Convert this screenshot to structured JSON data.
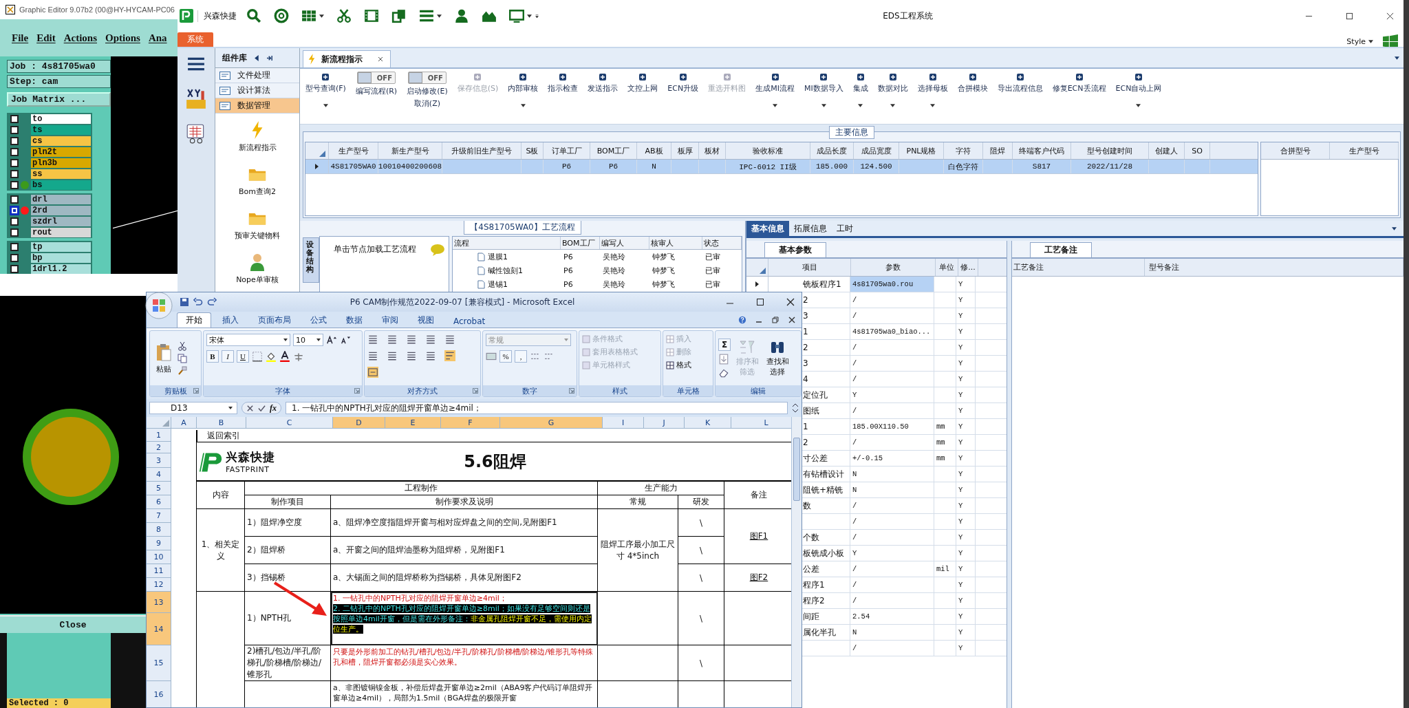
{
  "graphic_editor": {
    "title": "Graphic Editor 9.07b2 (00@HY-HYCAM-PC06",
    "menu": [
      "File",
      "Edit",
      "Actions",
      "Options",
      "Ana"
    ],
    "job": "Job : 4s81705wa0",
    "step": "Step: cam",
    "matrix_button": "Job Matrix ...",
    "layer_groups": [
      [
        {
          "name": "to",
          "color": "#ffffff",
          "selected": false
        },
        {
          "name": "ts",
          "color": "#14a88c",
          "selected": false
        },
        {
          "name": "cs",
          "color": "#f6c445",
          "selected": false
        },
        {
          "name": "pln2t",
          "color": "#d8a800",
          "selected": false
        },
        {
          "name": "pln3b",
          "color": "#d8a800",
          "selected": false
        },
        {
          "name": "ss",
          "color": "#f6c445",
          "selected": false
        },
        {
          "name": "bs",
          "color": "#14a88c",
          "selected": false,
          "dot": {
            "color": "#3c9a1c"
          }
        }
      ],
      [
        {
          "name": "drl",
          "color": "#9fb8c2",
          "selected": false
        },
        {
          "name": "2rd",
          "color": "#9fb8c2",
          "selected": true,
          "dot": {
            "color": "#ff1a1a"
          }
        },
        {
          "name": "szdrl",
          "color": "#9fb8c2",
          "selected": false
        },
        {
          "name": "rout",
          "color": "#d8d8d8",
          "selected": false
        }
      ],
      [
        {
          "name": "tp",
          "color": "#a8dfda",
          "selected": false
        },
        {
          "name": "bp",
          "color": "#a8dfda",
          "selected": false
        },
        {
          "name": "1drl1.2",
          "color": "#a8dfda",
          "selected": false
        }
      ]
    ],
    "close_button": "Close",
    "selected_count": "Selected : 0"
  },
  "eds": {
    "brand": "兴森快捷",
    "title": "EDS工程系统",
    "system_tab": "系统",
    "style_menu": "Style",
    "sidebar_title": "组件库",
    "modules": [
      {
        "label": "文件处理",
        "selected": false
      },
      {
        "label": "设计算法",
        "selected": false
      },
      {
        "label": "数据管理",
        "selected": true
      }
    ],
    "launchers": [
      "新流程指示",
      "Bom查询2",
      "预审关键物料",
      "Nope单审核"
    ],
    "doc_tab": "新流程指示",
    "toolbar": [
      {
        "kind": "button",
        "label": "型号查询(F)",
        "disabled": false,
        "menu": true
      },
      {
        "kind": "toggle",
        "label": "编写流程(R)",
        "switch_text": "OFF",
        "on": false
      },
      {
        "kind": "toggle",
        "label": "启动修改(E)",
        "sublabel": "取消(Z)",
        "switch_text": "OFF",
        "on": false
      },
      {
        "kind": "button",
        "label": "保存信息(S)",
        "disabled": true,
        "menu": false
      },
      {
        "kind": "button",
        "label": "内部审核",
        "disabled": false,
        "menu": true
      },
      {
        "kind": "button",
        "label": "指示检查",
        "disabled": false,
        "menu": false
      },
      {
        "kind": "button",
        "label": "发送指示",
        "disabled": false,
        "menu": false
      },
      {
        "kind": "button",
        "label": "文控上网",
        "disabled": false,
        "menu": false
      },
      {
        "kind": "button",
        "label": "ECN升级",
        "disabled": false,
        "menu": false
      },
      {
        "kind": "button",
        "label": "重选开料图",
        "disabled": true,
        "menu": false
      },
      {
        "kind": "button",
        "label": "生成MI流程",
        "disabled": false,
        "menu": true
      },
      {
        "kind": "button",
        "label": "MI数据导入",
        "disabled": false,
        "menu": true
      },
      {
        "kind": "button",
        "label": "集成",
        "disabled": false,
        "menu": true
      },
      {
        "kind": "button",
        "label": "数据对比",
        "disabled": false,
        "menu": true
      },
      {
        "kind": "button",
        "label": "选择母板",
        "disabled": false,
        "menu": true
      },
      {
        "kind": "button",
        "label": "合拼模块",
        "disabled": false,
        "menu": false
      },
      {
        "kind": "button",
        "label": "导出流程信息",
        "disabled": false,
        "menu": false
      },
      {
        "kind": "button",
        "label": "修复ECN丢流程",
        "disabled": false,
        "menu": false
      },
      {
        "kind": "button",
        "label": "ECN自动上网",
        "disabled": false,
        "menu": true
      }
    ],
    "main_info": {
      "title": "主要信息",
      "columns": [
        "生产型号",
        "新生产型号",
        "升级前旧生产型号",
        "S板",
        "订单工厂",
        "BOM工厂",
        "AB板",
        "板厚",
        "板材",
        "验收标准",
        "成品长度",
        "成品宽度",
        "PNL规格",
        "字符",
        "阻焊",
        "终端客户代码",
        "型号创建时间",
        "创建人",
        "SO"
      ],
      "rows": [
        {
          "selected": true,
          "cells": [
            "4S81705WA0",
            "10010400200608",
            null,
            null,
            "P6",
            "P6",
            "N",
            null,
            null,
            "IPC-6012 II级",
            "185.000",
            "124.500",
            null,
            "白色字符",
            null,
            "S817",
            "2022/11/28",
            null,
            null
          ]
        }
      ],
      "merge_columns": [
        "合拼型号",
        "生产型号"
      ]
    },
    "flow": {
      "title": "【4S81705WA0】工艺流程",
      "side_tab": "设备结构",
      "hint": "单击节点加载工艺流程",
      "columns": [
        "流程",
        "BOM工厂",
        "编写人",
        "核审人",
        "状态"
      ],
      "rows": [
        [
          "退膜1",
          "P6",
          "吴艳玲",
          "钟梦飞",
          "已审"
        ],
        [
          "碱性蚀刻1",
          "P6",
          "吴艳玲",
          "钟梦飞",
          "已审"
        ],
        [
          "退锡1",
          "P6",
          "吴艳玲",
          "钟梦飞",
          "已审"
        ]
      ]
    },
    "detail_tabs": [
      {
        "label": "基本信息",
        "selected": true
      },
      {
        "label": "拓展信息",
        "selected": false
      },
      {
        "label": "工时",
        "selected": false
      }
    ],
    "params": {
      "tab": "基本参数",
      "columns": [
        "项目",
        "参数",
        "单位",
        "修..."
      ],
      "rows": [
        {
          "item": "铣板程序1",
          "value": "4s81705wa0.rou",
          "flag": "Y",
          "selected": true
        },
        {
          "item": "2",
          "value": "/",
          "flag": "Y",
          "selected": false
        },
        {
          "item": "3",
          "value": "/",
          "flag": "Y",
          "selected": false
        },
        {
          "item": "1",
          "value": "4s81705wa0_biao...",
          "flag": "Y",
          "selected": false
        },
        {
          "item": "2",
          "value": "/",
          "flag": "Y",
          "selected": false
        },
        {
          "item": "3",
          "value": "/",
          "flag": "Y",
          "selected": false
        },
        {
          "item": "4",
          "value": "/",
          "flag": "Y",
          "selected": false
        },
        {
          "item": "定位孔",
          "value": "Y",
          "flag": "Y",
          "selected": false
        },
        {
          "item": "图纸",
          "value": "/",
          "flag": "Y",
          "selected": false
        },
        {
          "item": "1",
          "value": "185.00X110.50",
          "unit": "mm",
          "flag": "Y",
          "selected": false
        },
        {
          "item": "2",
          "value": "/",
          "unit": "mm",
          "flag": "Y",
          "selected": false
        },
        {
          "item": "寸公差",
          "value": "+/-0.15",
          "unit": "mm",
          "flag": "Y",
          "selected": false
        },
        {
          "item": "有钻槽设计",
          "value": "N",
          "flag": "Y",
          "selected": false
        },
        {
          "item": "阻铣+精铣",
          "value": "N",
          "flag": "Y",
          "selected": false
        },
        {
          "item": "数",
          "value": "/",
          "flag": "Y",
          "selected": false
        },
        {
          "value": "/",
          "flag": "Y",
          "selected": false
        },
        {
          "item": "个数",
          "value": "/",
          "flag": "Y",
          "selected": false
        },
        {
          "item": "板铣成小板",
          "value": "Y",
          "flag": "Y",
          "selected": false
        },
        {
          "item": "公差",
          "value": "/",
          "unit": "mil",
          "flag": "Y",
          "selected": false
        },
        {
          "item": "程序1",
          "value": "/",
          "flag": "Y",
          "selected": false
        },
        {
          "item": "程序2",
          "value": "/",
          "flag": "Y",
          "selected": false
        },
        {
          "item": "间距",
          "value": "2.54",
          "flag": "Y",
          "selected": false
        },
        {
          "item": "属化半孔",
          "value": "N",
          "flag": "Y",
          "selected": false
        },
        {
          "value": "/",
          "flag": "Y",
          "selected": false
        }
      ]
    },
    "notes": {
      "tab": "工艺备注",
      "columns": [
        "工艺备注",
        "型号备注"
      ]
    }
  },
  "excel": {
    "title": "P6 CAM制作规范2022-09-07  [兼容模式] - Microsoft Excel",
    "tabs": [
      {
        "label": "开始",
        "selected": true
      },
      {
        "label": "插入",
        "selected": false
      },
      {
        "label": "页面布局",
        "selected": false
      },
      {
        "label": "公式",
        "selected": false
      },
      {
        "label": "数据",
        "selected": false
      },
      {
        "label": "审阅",
        "selected": false
      },
      {
        "label": "视图",
        "selected": false
      },
      {
        "label": "Acrobat",
        "selected": false
      }
    ],
    "ribbon": {
      "paste": "粘贴",
      "font_name": "宋体",
      "font_size": "10",
      "style_buttons": [
        "B",
        "I",
        "U"
      ],
      "number_format": "常规",
      "number_buttons": [
        "%",
        ","
      ],
      "styles": [
        {
          "label": "条件格式",
          "disabled": true
        },
        {
          "label": "套用表格格式",
          "disabled": true
        },
        {
          "label": "单元格样式",
          "disabled": true
        }
      ],
      "cells": [
        {
          "label": "插入",
          "disabled": true
        },
        {
          "label": "删除",
          "disabled": true
        },
        {
          "label": "格式",
          "disabled": false
        }
      ],
      "sum": "Σ",
      "edit": [
        {
          "label": "排序和筛选",
          "disabled": true
        },
        {
          "label": "查找和选择",
          "disabled": false
        }
      ],
      "groups": [
        "剪贴板",
        "字体",
        "对齐方式",
        "数字",
        "样式",
        "单元格",
        "编辑"
      ]
    },
    "name_box": "D13",
    "function_label": "fx",
    "formula": "1. 一钻孔中的NPTH孔对应的阻焊开窗单边≥4mil；",
    "columns": [
      {
        "label": "A",
        "selected": false
      },
      {
        "label": "B",
        "selected": false
      },
      {
        "label": "C",
        "selected": false
      },
      {
        "label": "D",
        "selected": true
      },
      {
        "label": "E",
        "selected": true
      },
      {
        "label": "F",
        "selected": true
      },
      {
        "label": "G",
        "selected": true
      },
      {
        "label": "I",
        "selected": false
      },
      {
        "label": "J",
        "selected": false
      },
      {
        "label": "K",
        "selected": false
      },
      {
        "label": "L",
        "selected": false
      }
    ],
    "rows": [
      {
        "label": "1",
        "selected": false
      },
      {
        "label": "2",
        "selected": false
      },
      {
        "label": "3",
        "selected": false
      },
      {
        "label": "4",
        "selected": false
      },
      {
        "label": "5",
        "selected": false
      },
      {
        "label": "6",
        "selected": false
      },
      {
        "label": "7",
        "selected": false
      },
      {
        "label": "8",
        "selected": false
      },
      {
        "label": "9",
        "selected": false
      },
      {
        "label": "10",
        "selected": false
      },
      {
        "label": "11",
        "selected": false
      },
      {
        "label": "12",
        "selected": false
      },
      {
        "label": "13",
        "selected": true
      },
      {
        "label": "14",
        "selected": true
      },
      {
        "label": "15",
        "selected": false
      },
      {
        "label": "16",
        "selected": false
      }
    ],
    "sheet": {
      "back_link": "返回索引",
      "logo_cn": "兴森快捷",
      "logo_en": "FASTPRINT",
      "title": "5.6阻焊",
      "head": {
        "content": "内容",
        "engineering": "工程制作",
        "capability": "生产能力",
        "remarks": "备注",
        "item": "制作项目",
        "requirement": "制作要求及说明",
        "normal": "常规",
        "rd": "研发"
      },
      "section1": {
        "name": "1、相关定义",
        "capability": "阻焊工序最小加工尺寸 4*5inch",
        "refs": [
          "图F1",
          "图F2"
        ],
        "items": [
          {
            "item": "1）阻焊净空度",
            "requirement": "a、阻焊净空度指阻焊开窗与相对应焊盘之间的空间,见附图F1",
            "rd": "\\"
          },
          {
            "item": "2）阻焊桥",
            "requirement": "a、开窗之间的阻焊油墨称为阻焊桥，见附图F1",
            "rd": "\\"
          },
          {
            "item": "3）挡锡桥",
            "requirement": "a、大锡面之间的阻焊桥称为挡锡桥，具体见附图F2",
            "rd": "\\"
          }
        ]
      },
      "section2": {
        "items": [
          {
            "item": "1）NPTH孔",
            "rd": "\\",
            "parts": [
              {
                "kind": "red",
                "text": "1. 一钻孔中的NPTH孔对应的阻焊开窗单边≥4mil；"
              },
              {
                "kind": "highlight",
                "text": "2. 二钻孔中的NPTH孔对应的阻焊开窗单边≥8mil；如果没有足够空间则还是按照单边4mil开窗，但是需在外形备注："
              },
              {
                "kind": "highlight_warn",
                "text": "非金属孔阻焊开窗不足，需使用内定位生产。"
              }
            ]
          },
          {
            "item": "2)槽孔/包边/半孔/阶梯孔/阶梯槽/阶梯边/锥形孔",
            "rd": "\\",
            "parts": [
              {
                "kind": "red",
                "text": "只要是外形前加工的钻孔/槽孔/包边/半孔/阶梯孔/阶梯槽/阶梯边/锥形孔等特殊孔和槽，阻焊开窗都必须是实心效果。"
              }
            ]
          },
          {
            "parts": [
              {
                "kind": "plain",
                "text": "a、非图镀铜镍金板，补偿后焊盘开窗单边≥2mil（ABA9客户代码订单阻焊开窗单边≥4mil），局部为1.5mil（BGA焊盘的极限开窗"
              }
            ]
          }
        ]
      }
    }
  }
}
